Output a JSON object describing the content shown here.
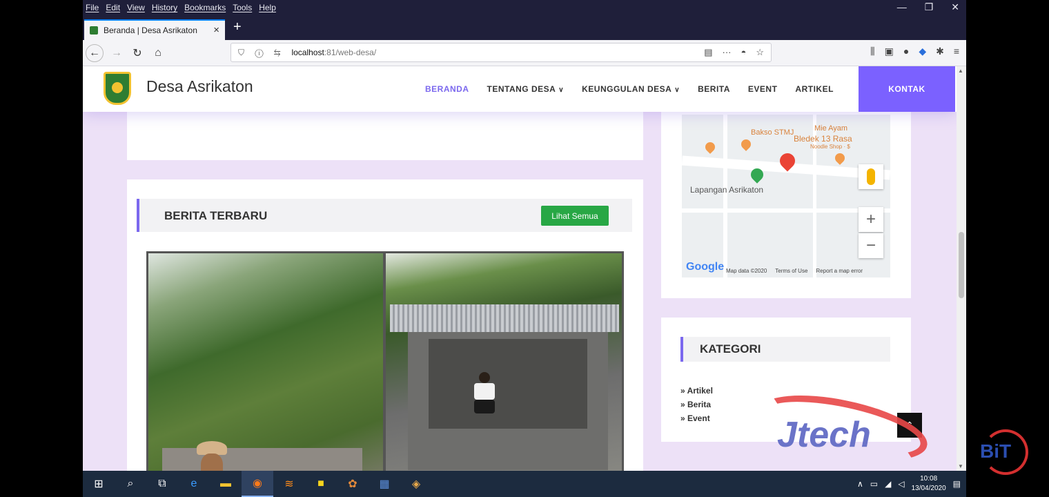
{
  "browser": {
    "menu": [
      "File",
      "Edit",
      "View",
      "History",
      "Bookmarks",
      "Tools",
      "Help"
    ],
    "window_controls": [
      "—",
      "❐",
      "✕"
    ],
    "tab_title": "Beranda | Desa Asrikaton",
    "tab_close": "×",
    "new_tab": "+",
    "url_host": "localhost",
    "url_path": ":81/web-desa/",
    "url_icons": "⛉ ⓘ ⇆"
  },
  "site": {
    "title": "Desa Asrikaton",
    "menu": [
      {
        "label": "BERANDA"
      },
      {
        "label": "TENTANG DESA",
        "caret": "∨"
      },
      {
        "label": "KEUNGGULAN DESA",
        "caret": "∨"
      },
      {
        "label": "BERITA"
      },
      {
        "label": "EVENT"
      },
      {
        "label": "ARTIKEL"
      }
    ],
    "contact": "KONTAK",
    "colors": {
      "accent": "#7b61ff",
      "page_bg": "#ede1f7",
      "button_green": "#28a745"
    }
  },
  "news": {
    "title": "BERITA TERBARU",
    "see_all": "Lihat Semua"
  },
  "map": {
    "labels": {
      "bakso": "Bakso STMJ",
      "mie": "Mie Ayam",
      "bledek": "Bledek 13 Rasa",
      "noodle": "Noodle Shop · $",
      "lapangan": "Lapangan Asrikaton"
    },
    "google": "Google",
    "footer": [
      "Map data ©2020",
      "Terms of Use",
      "Report a map error"
    ],
    "zoom_in": "+",
    "zoom_out": "−"
  },
  "category": {
    "title": "KATEGORI",
    "items": [
      "» Artikel",
      "» Berita",
      "» Event"
    ]
  },
  "watermark": {
    "jtech": "Jtech",
    "bit": "BiT"
  },
  "taskbar": {
    "time": "10:08",
    "date": "13/04/2020"
  }
}
